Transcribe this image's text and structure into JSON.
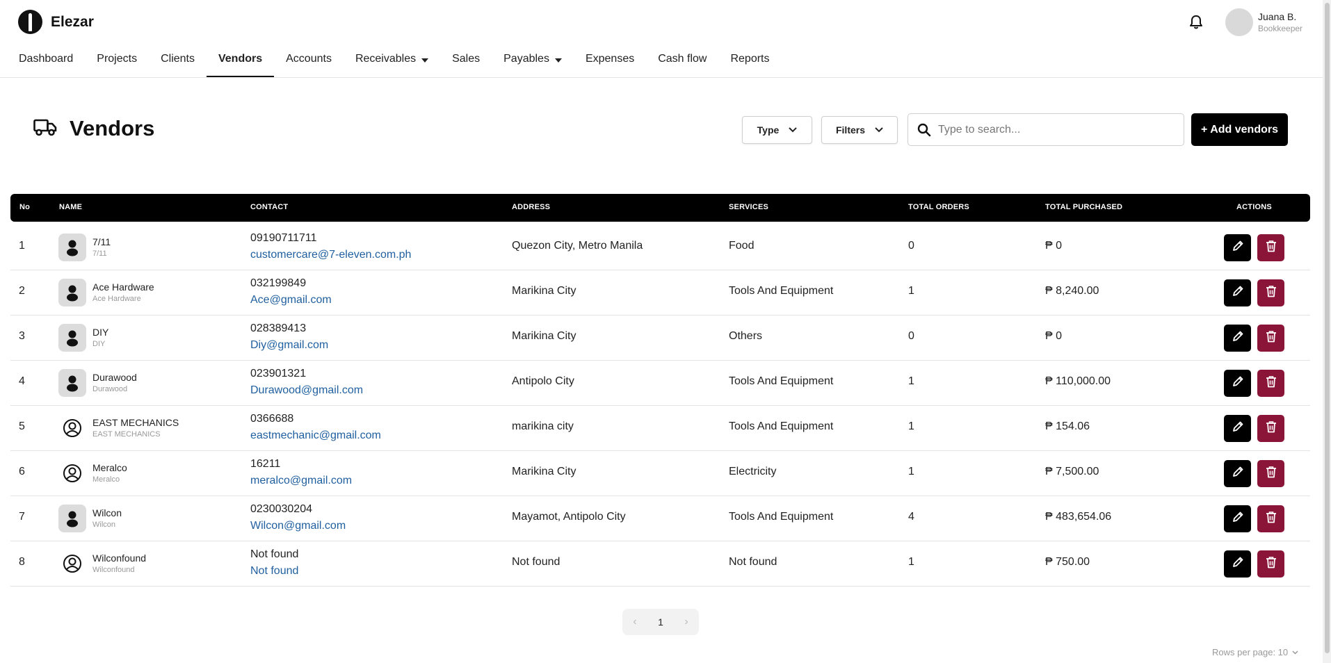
{
  "app": {
    "name": "Elezar"
  },
  "user": {
    "name": "Juana B.",
    "role": "Bookkeeper"
  },
  "nav": [
    {
      "label": "Dashboard"
    },
    {
      "label": "Projects"
    },
    {
      "label": "Clients"
    },
    {
      "label": "Vendors",
      "active": true
    },
    {
      "label": "Accounts"
    },
    {
      "label": "Receivables",
      "dropdown": true
    },
    {
      "label": "Sales"
    },
    {
      "label": "Payables",
      "dropdown": true
    },
    {
      "label": "Expenses"
    },
    {
      "label": "Cash flow"
    },
    {
      "label": "Reports"
    }
  ],
  "page": {
    "title": "Vendors"
  },
  "toolbar": {
    "type_label": "Type",
    "filters_label": "Filters",
    "search_placeholder": "Type to search...",
    "add_label": "+ Add vendors"
  },
  "table": {
    "headers": {
      "no": "No",
      "name": "NAME",
      "contact": "CONTACT",
      "address": "ADDRESS",
      "services": "SERVICES",
      "total_orders": "TOTAL ORDERS",
      "total_purchased": "TOTAL PURCHASED",
      "actions": "ACTIONS"
    },
    "rows": [
      {
        "no": "1",
        "name": "7/11",
        "name_sub": "7/11",
        "avatar": "filled",
        "phone": "09190711711",
        "email": "customercare@7-eleven.com.ph",
        "address": "Quezon City, Metro Manila",
        "services": "Food",
        "orders": "0",
        "total": "₱ 0"
      },
      {
        "no": "2",
        "name": "Ace Hardware",
        "name_sub": "Ace Hardware",
        "avatar": "filled",
        "phone": "032199849",
        "email": "Ace@gmail.com",
        "address": "Marikina City",
        "services": "Tools And Equipment",
        "orders": "1",
        "total": "₱ 8,240.00"
      },
      {
        "no": "3",
        "name": "DIY",
        "name_sub": "DIY",
        "avatar": "filled",
        "phone": "028389413",
        "email": "Diy@gmail.com",
        "address": "Marikina City",
        "services": "Others",
        "orders": "0",
        "total": "₱ 0"
      },
      {
        "no": "4",
        "name": "Durawood",
        "name_sub": "Durawood",
        "avatar": "filled",
        "phone": "023901321",
        "email": "Durawood@gmail.com",
        "address": "Antipolo City",
        "services": "Tools And Equipment",
        "orders": "1",
        "total": "₱ 110,000.00"
      },
      {
        "no": "5",
        "name": "EAST MECHANICS",
        "name_sub": "EAST MECHANICS",
        "avatar": "outline",
        "phone": "0366688",
        "email": "eastmechanic@gmail.com",
        "address": "marikina city",
        "services": "Tools And Equipment",
        "orders": "1",
        "total": "₱ 154.06"
      },
      {
        "no": "6",
        "name": "Meralco",
        "name_sub": "Meralco",
        "avatar": "outline",
        "phone": "16211",
        "email": "meralco@gmail.com",
        "address": "Marikina City",
        "services": "Electricity",
        "orders": "1",
        "total": "₱ 7,500.00"
      },
      {
        "no": "7",
        "name": "Wilcon",
        "name_sub": "Wilcon",
        "avatar": "filled",
        "phone": "0230030204",
        "email": "Wilcon@gmail.com",
        "address": "Mayamot, Antipolo City",
        "services": "Tools And Equipment",
        "orders": "4",
        "total": "₱ 483,654.06"
      },
      {
        "no": "8",
        "name": "Wilconfound",
        "name_sub": "Wilconfound",
        "avatar": "outline",
        "phone": "Not found",
        "email": "Not found",
        "address": "Not found",
        "services": "Not found",
        "orders": "1",
        "total": "₱ 750.00"
      }
    ]
  },
  "pagination": {
    "prev": "‹",
    "current_page": "1",
    "next": "›",
    "rows_per_page": "Rows per page: 10"
  },
  "colors": {
    "primary": "#000000",
    "delete": "#8b1538",
    "link": "#1f5f9f"
  },
  "icons": [
    "logo-icon",
    "bell-icon",
    "truck-icon",
    "chevron-down-icon",
    "search-icon",
    "user-icon",
    "pencil-icon",
    "trash-icon"
  ]
}
